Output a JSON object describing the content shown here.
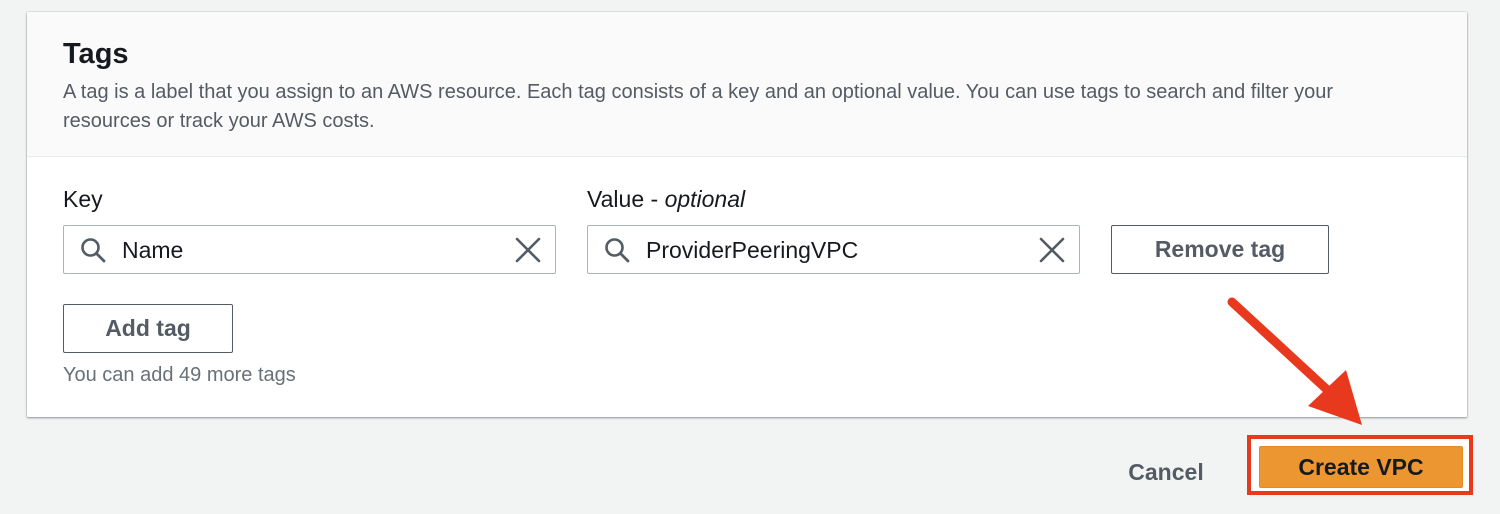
{
  "tags": {
    "title": "Tags",
    "description": "A tag is a label that you assign to an AWS resource. Each tag consists of a key and an optional value. You can use tags to search and filter your resources or track your AWS costs.",
    "key_label": "Key",
    "value_label_prefix": "Value - ",
    "value_label_optional": "optional",
    "rows": [
      {
        "key": "Name",
        "value": "ProviderPeeringVPC"
      }
    ],
    "remove_tag_label": "Remove tag",
    "add_tag_label": "Add tag",
    "remaining_hint": "You can add 49 more tags"
  },
  "footer": {
    "cancel_label": "Cancel",
    "create_label": "Create VPC"
  },
  "icons": {
    "search": "search-icon",
    "clear": "close-icon",
    "annotation": "arrow-annotation"
  },
  "colors": {
    "primary_button": "#ec9632",
    "annotation": "#e8391e",
    "page_background": "#f2f3f3"
  }
}
